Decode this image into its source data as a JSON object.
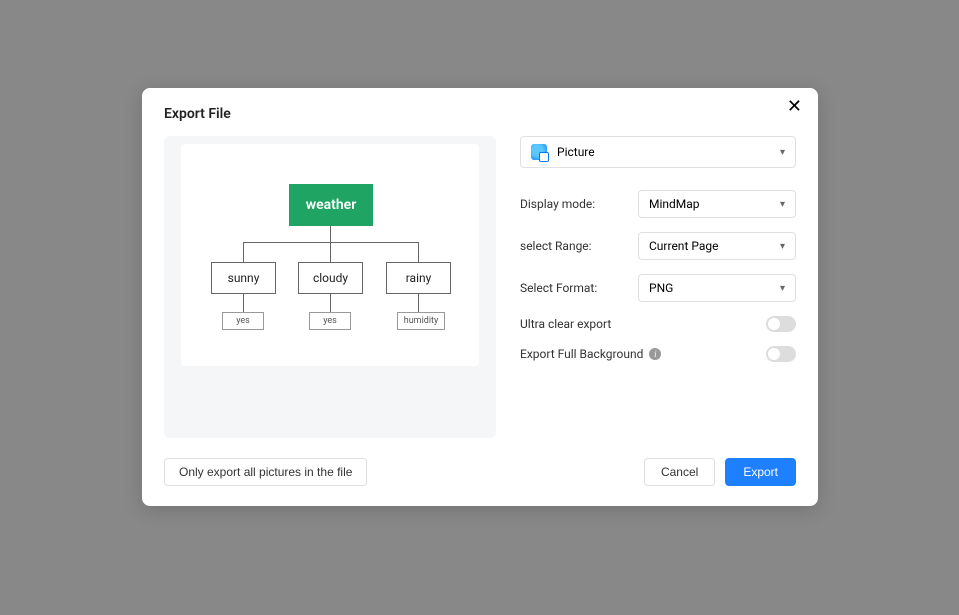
{
  "title": "Export File",
  "preview": {
    "root": "weather",
    "children": [
      "sunny",
      "cloudy",
      "rainy"
    ],
    "leaves": [
      "yes",
      "yes",
      "humidity"
    ]
  },
  "picture_select": {
    "label": "Picture"
  },
  "rows": {
    "display_mode": {
      "label": "Display mode:",
      "value": "MindMap"
    },
    "select_range": {
      "label": "select Range:",
      "value": "Current Page"
    },
    "select_format": {
      "label": "Select Format:",
      "value": "PNG"
    }
  },
  "toggles": {
    "ultra_clear": {
      "label": "Ultra clear export"
    },
    "full_bg": {
      "label": "Export Full Background"
    }
  },
  "footer": {
    "only_export": "Only export all pictures in the file",
    "cancel": "Cancel",
    "export": "Export"
  }
}
